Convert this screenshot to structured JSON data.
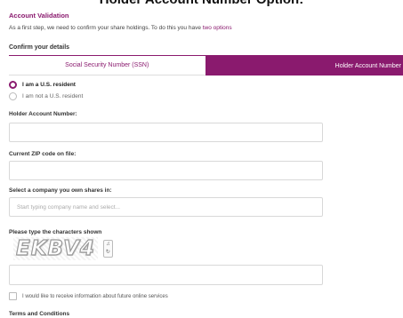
{
  "page": {
    "heading": "Holder Account Number Option:"
  },
  "validation": {
    "title": "Account Validation",
    "intro_text": "As a first step, we need to confirm your share holdings. To do this you have ",
    "intro_link": "two options"
  },
  "confirm": {
    "label": "Confirm your details",
    "tabs": [
      {
        "label": "Social Security Number (SSN)",
        "active": false
      },
      {
        "label": "Holder Account Number",
        "active": true
      }
    ]
  },
  "residency": {
    "options": [
      {
        "label": "I am a U.S. resident",
        "checked": true
      },
      {
        "label": "I am not a U.S. resident",
        "checked": false
      }
    ]
  },
  "form": {
    "holder_label": "Holder Account Number:",
    "holder_value": "",
    "zip_label": "Current ZIP code on file:",
    "zip_value": "",
    "company_label": "Select a company you own shares in:",
    "company_placeholder": "Start typing company name and select...",
    "captcha_label": "Please type the characters shown",
    "captcha_text": "EKBV4",
    "captcha_value": "",
    "optin_label": "I would like to receive information about future online services",
    "optin_checked": false
  },
  "terms": {
    "title": "Terms and Conditions"
  },
  "colors": {
    "accent": "#8a1a6e"
  }
}
